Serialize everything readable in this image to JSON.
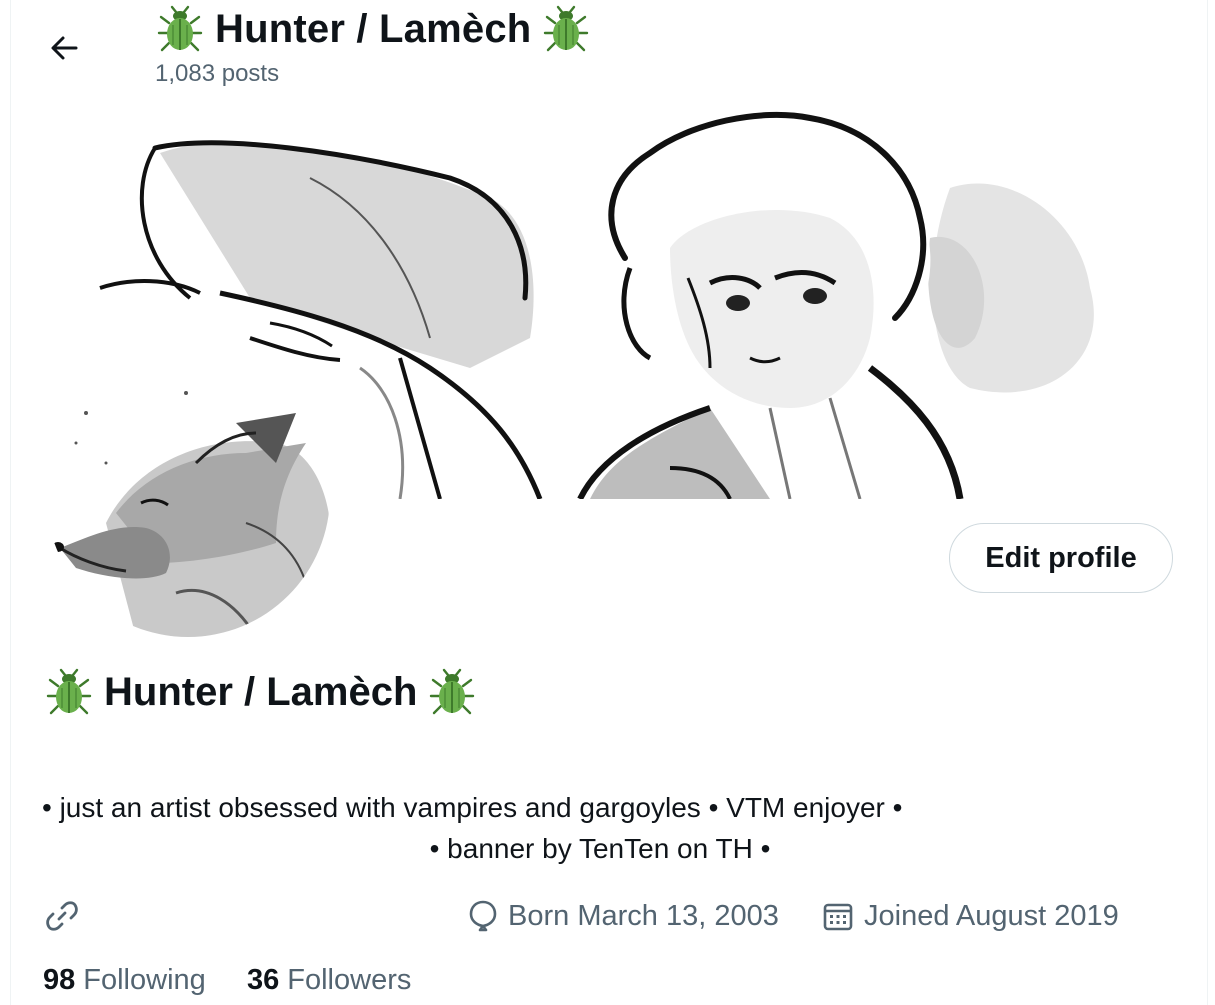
{
  "header": {
    "back_label": "Back",
    "title": "Hunter / Lamèch",
    "post_count": "1,083 posts"
  },
  "icons": {
    "back": "arrow-left-icon",
    "title_emoji": "beetle-icon",
    "link": "link-icon",
    "birthday": "balloon-icon",
    "joined": "calendar-icon"
  },
  "colors": {
    "text_primary": "#0f1419",
    "text_secondary": "#536471",
    "border": "#cfd9de",
    "beetle_green": "#6ab04c"
  },
  "profile": {
    "edit_button_label": "Edit profile",
    "display_name": "Hunter / Lamèch",
    "bio_line_1": "• just an artist obsessed with vampires and gargoyles • VTM enjoyer •",
    "bio_line_2": "• banner by TenTen on TH •",
    "birthday": "Born March 13, 2003",
    "joined": "Joined August 2019",
    "following_count": "98",
    "following_label": "Following",
    "followers_count": "36",
    "followers_label": "Followers"
  }
}
